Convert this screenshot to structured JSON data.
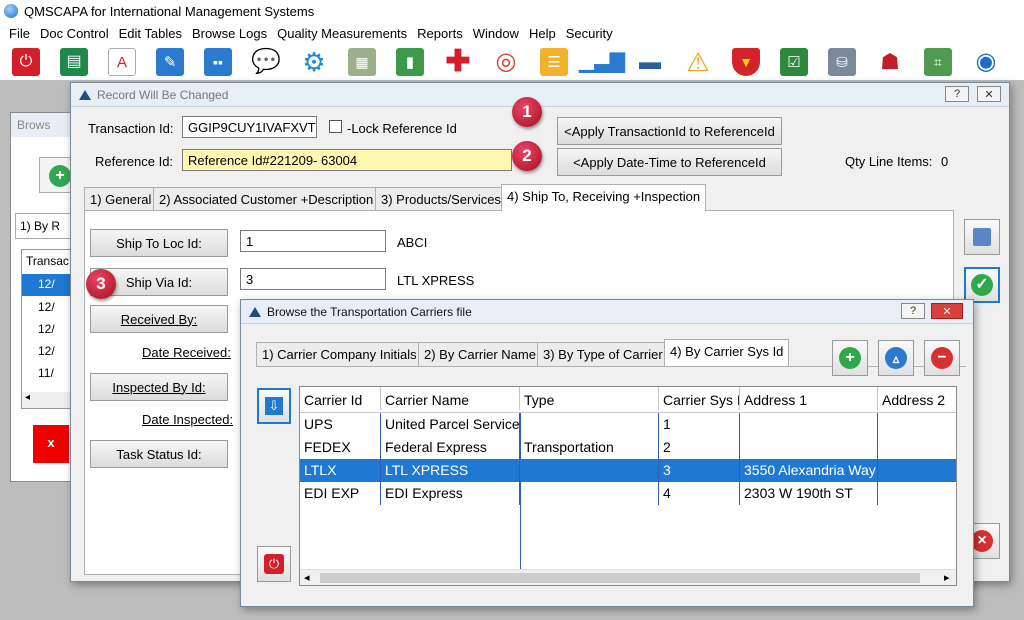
{
  "app": {
    "title": "QMSCAPA for International Management Systems"
  },
  "menu": [
    "File",
    "Doc Control",
    "Edit Tables",
    "Browse Logs",
    "Quality Measurements",
    "Reports",
    "Window",
    "Help",
    "Security"
  ],
  "toolbar_icons": [
    "power-icon",
    "document-list-icon",
    "pdf-icon",
    "pencil-book-icon",
    "org-chart-icon",
    "chat-icon",
    "gear-icon",
    "calendar-icon",
    "bookmark-book-icon",
    "red-cross-icon",
    "lifebuoy-icon",
    "notepad-icon",
    "bar-chart-icon",
    "printer-icon",
    "warning-icon",
    "shield-icon",
    "checklist-icon",
    "database-icon",
    "contact-card-icon",
    "clipboard-chart-icon",
    "globe-search-icon"
  ],
  "bg": {
    "title": "Brows",
    "tab": "1) By R",
    "col": "Transac",
    "rows": [
      "12/",
      "12/",
      "12/",
      "12/",
      "11/"
    ],
    "close": "x"
  },
  "record": {
    "title": "Record Will Be Changed",
    "help": "?",
    "close": "✕",
    "transaction_label": "Transaction Id:",
    "transaction_value": "GGIP9CUY1IVAFXVT",
    "lock_label": "-Lock Reference Id",
    "reference_label": "Reference Id:",
    "reference_value": "Reference Id#221209- 63004",
    "apply_txn": "<Apply TransactionId to ReferenceId",
    "apply_date": "<Apply Date-Time to ReferenceId",
    "qty_label": "Qty Line Items:",
    "qty_value": "0",
    "tabs": [
      "1) General",
      "2) Associated Customer +Description",
      "3) Products/Services",
      "4) Ship To, Receiving +Inspection"
    ],
    "ship_to_label": "Ship To Loc Id:",
    "ship_to_value": "1",
    "ship_to_name": "ABCI",
    "ship_via_label": "Ship Via Id:",
    "ship_via_value": "3",
    "ship_via_name": "LTL XPRESS",
    "received_by": "Received By:",
    "date_received": "Date Received:",
    "inspected_by": "Inspected By Id:",
    "date_inspected": "Date Inspected:",
    "task_status": "Task Status Id:"
  },
  "badges": [
    "1",
    "2",
    "3"
  ],
  "carriers": {
    "title": "Browse the Transportation Carriers file",
    "help": "?",
    "close": "✕",
    "tabs": [
      "1) Carrier Company Initials",
      "2) By Carrier Name",
      "3) By Type of Carrier",
      "4) By Carrier Sys Id"
    ],
    "columns": [
      "Carrier Id",
      "Carrier Name",
      "Type",
      "Carrier Sys Id",
      "Address 1",
      "Address 2"
    ],
    "rows": [
      [
        "UPS",
        "United Parcel Services",
        "",
        "1",
        "",
        ""
      ],
      [
        "FEDEX",
        "Federal Express",
        "Transportation",
        "2",
        "",
        ""
      ],
      [
        "LTLX",
        "LTL XPRESS",
        "",
        "3",
        "3550 Alexandria Way",
        ""
      ],
      [
        "EDI EXP",
        "EDI Express",
        "",
        "4",
        "2303 W 190th ST",
        ""
      ]
    ],
    "selected_row": 2,
    "add": "+",
    "search": "▵",
    "remove": "−"
  },
  "colors": {
    "accent": "#1f78d1",
    "desktop": "#bdbdbd",
    "highlight": "#fff7b0",
    "badge": "#c4162a"
  }
}
